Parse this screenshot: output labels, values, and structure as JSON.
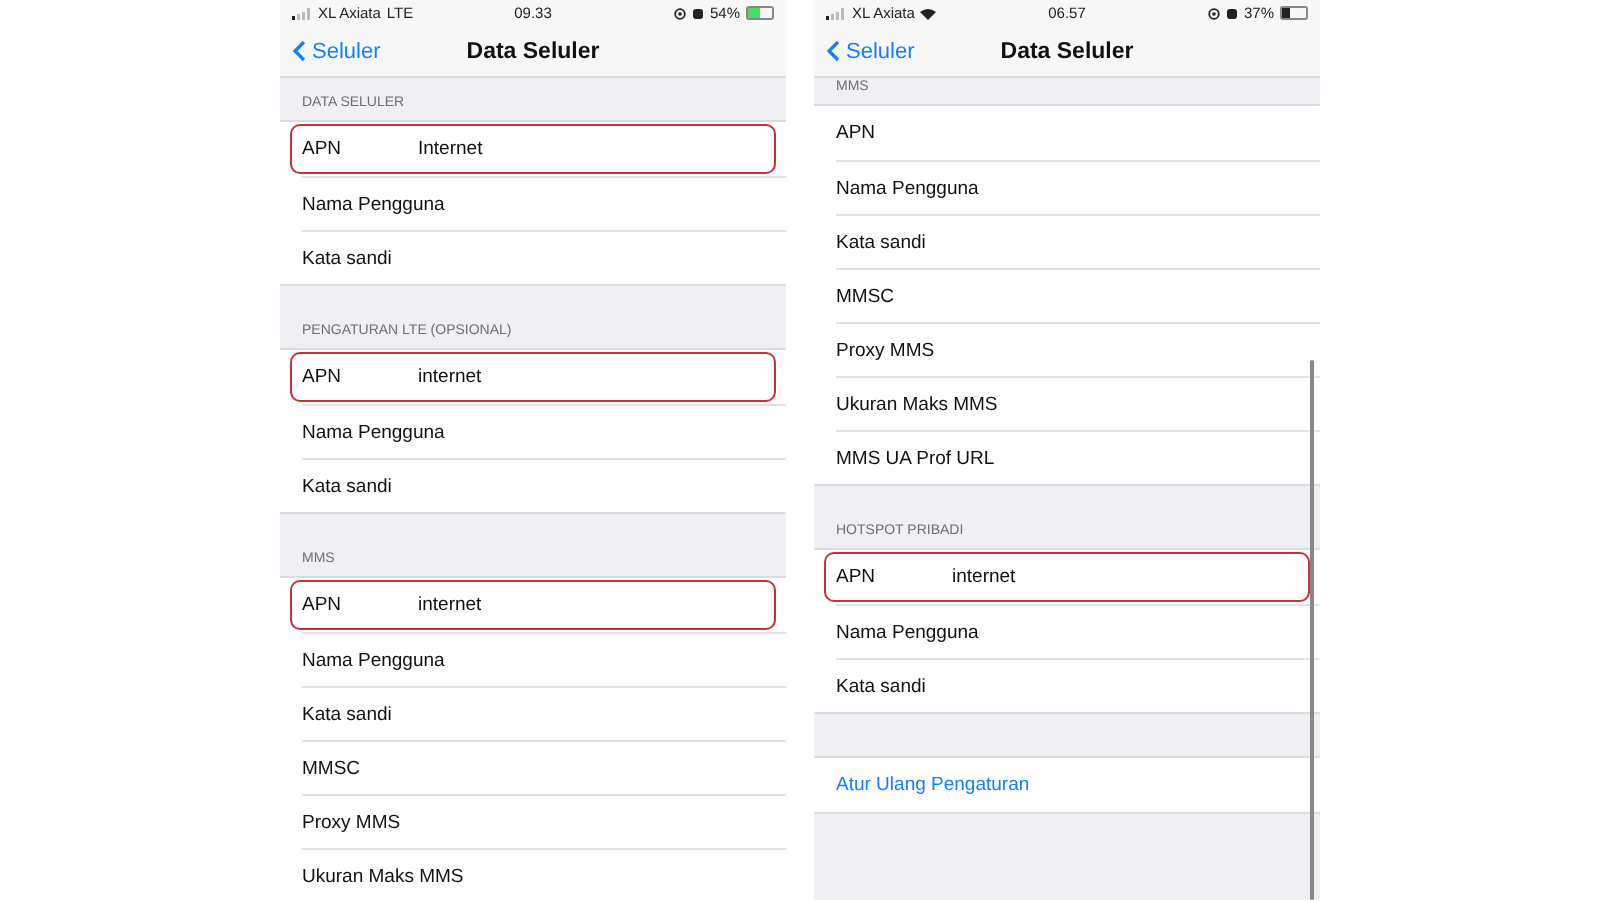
{
  "phones": [
    {
      "status": {
        "carrier": "XL Axiata",
        "network": "LTE",
        "time": "09.33",
        "battery": "54%",
        "level": 0.54,
        "charging": true
      },
      "nav": {
        "back": "Seluler",
        "title": "Data Seluler"
      },
      "sections": [
        {
          "header": "DATA SELULER",
          "rows": [
            {
              "kind": "field",
              "label": "APN",
              "value": "Internet",
              "highlighted": true
            },
            {
              "kind": "field",
              "label": "Nama Pengguna",
              "highlighted": false
            },
            {
              "kind": "field",
              "label": "Kata sandi",
              "highlighted": false
            }
          ]
        },
        {
          "header": "PENGATURAN LTE (OPSIONAL)",
          "rows": [
            {
              "kind": "field",
              "label": "APN",
              "value": "internet",
              "highlighted": true
            },
            {
              "kind": "field",
              "label": "Nama Pengguna",
              "highlighted": false
            },
            {
              "kind": "field",
              "label": "Kata sandi",
              "highlighted": false
            }
          ]
        },
        {
          "header": "MMS",
          "rows": [
            {
              "kind": "field",
              "label": "APN",
              "value": "internet",
              "highlighted": true
            },
            {
              "kind": "field",
              "label": "Nama Pengguna",
              "highlighted": false
            },
            {
              "kind": "field",
              "label": "Kata sandi",
              "highlighted": false
            },
            {
              "kind": "field",
              "label": "MMSC",
              "highlighted": false
            },
            {
              "kind": "field",
              "label": "Proxy MMS",
              "highlighted": false
            },
            {
              "kind": "field",
              "label": "Ukuran Maks MMS",
              "highlighted": false
            }
          ]
        }
      ]
    },
    {
      "status": {
        "carrier": "XL Axiata",
        "wifi": true,
        "time": "06.57",
        "battery": "37%",
        "level": 0.37,
        "charging": false
      },
      "nav": {
        "back": "Seluler",
        "title": "Data Seluler"
      },
      "scrollbar": true,
      "sections": [
        {
          "header": "MMS",
          "rows": [
            {
              "kind": "field",
              "label": "APN",
              "highlighted": false
            },
            {
              "kind": "field",
              "label": "Nama Pengguna",
              "highlighted": false
            },
            {
              "kind": "field",
              "label": "Kata sandi",
              "highlighted": false
            },
            {
              "kind": "field",
              "label": "MMSC",
              "highlighted": false
            },
            {
              "kind": "field",
              "label": "Proxy MMS",
              "highlighted": false
            },
            {
              "kind": "field",
              "label": "Ukuran Maks MMS",
              "highlighted": false
            },
            {
              "kind": "field",
              "label": "MMS UA Prof URL",
              "highlighted": false
            }
          ]
        },
        {
          "header": "HOTSPOT PRIBADI",
          "rows": [
            {
              "kind": "field",
              "label": "APN",
              "value": "internet",
              "highlighted": true
            },
            {
              "kind": "field",
              "label": "Nama Pengguna",
              "highlighted": false
            },
            {
              "kind": "field",
              "label": "Kata sandi",
              "highlighted": false
            }
          ]
        },
        {
          "rows": [
            {
              "kind": "link",
              "label": "Atur Ulang Pengaturan",
              "highlighted": false
            }
          ]
        }
      ]
    }
  ]
}
